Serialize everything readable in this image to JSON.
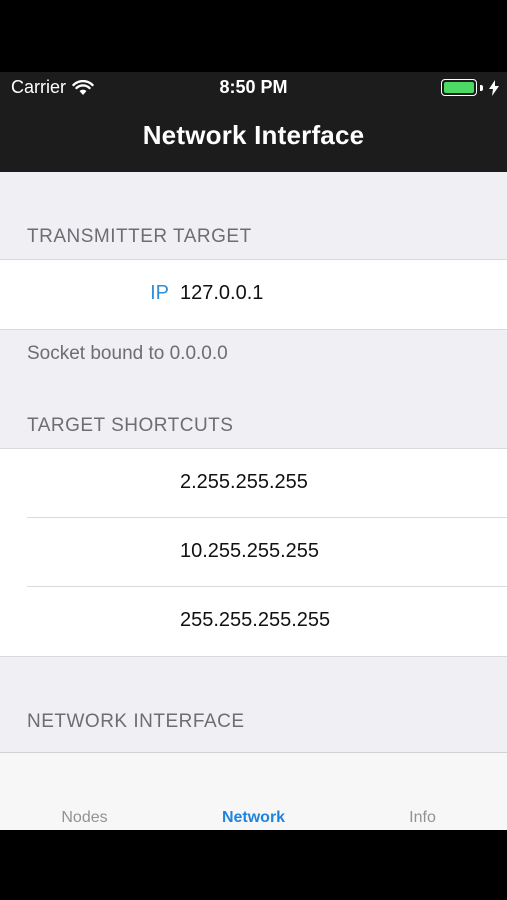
{
  "status_bar": {
    "carrier": "Carrier",
    "time": "8:50 PM"
  },
  "nav": {
    "title": "Network Interface"
  },
  "sections": {
    "transmitter": {
      "header": "TRANSMITTER TARGET",
      "ip_label": "IP",
      "ip_value": "127.0.0.1",
      "footer": "Socket bound to 0.0.0.0"
    },
    "shortcuts": {
      "header": "TARGET SHORTCUTS",
      "items": [
        "2.255.255.255",
        "10.255.255.255",
        "255.255.255.255"
      ]
    },
    "interface": {
      "header": "NETWORK INTERFACE"
    }
  },
  "tabs": [
    {
      "label": "Nodes",
      "active": false
    },
    {
      "label": "Network",
      "active": true
    },
    {
      "label": "Info",
      "active": false
    }
  ],
  "colors": {
    "accent": "#1e84e0",
    "battery": "#4cd964",
    "navbar": "#1c1c1c"
  }
}
